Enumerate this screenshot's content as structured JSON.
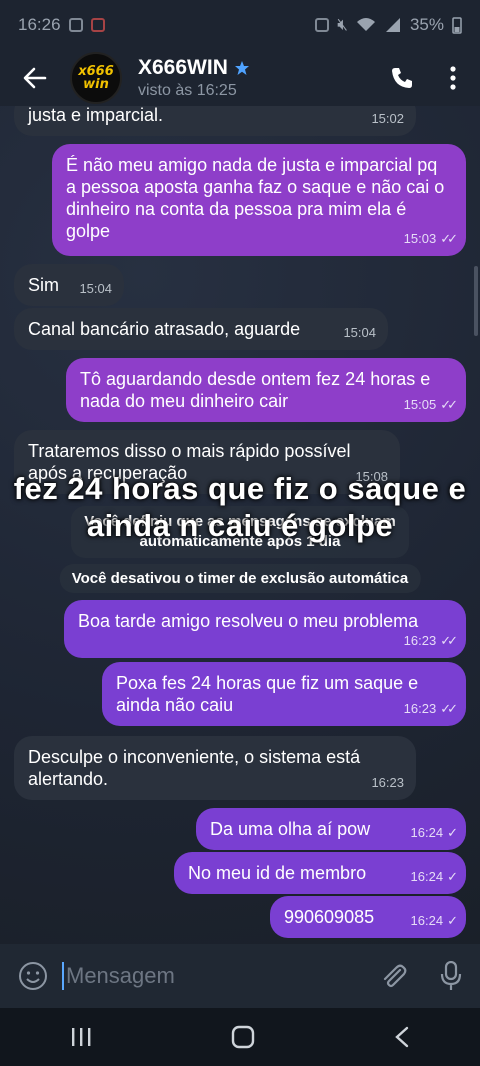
{
  "status": {
    "time": "16:26",
    "battery": "35%"
  },
  "header": {
    "name": "X666WIN",
    "last_seen": "visto às 16:25",
    "avatar_line1": "x666",
    "avatar_line2": "win"
  },
  "messages": [
    {
      "text": "justa e imparcial.",
      "time": "15:02"
    },
    {
      "text": "É não meu amigo nada de justa e imparcial pq a pessoa aposta ganha faz o saque e não cai o dinheiro na conta da pessoa pra mim ela é golpe",
      "time": "15:03"
    },
    {
      "text": "Sim",
      "time": "15:04"
    },
    {
      "text": "Canal bancário atrasado, aguarde",
      "time": "15:04"
    },
    {
      "text": "Tô aguardando desde ontem fez 24 horas e nada do meu dinheiro cair",
      "time": "15:05"
    },
    {
      "text": "Trataremos disso o mais rápido possível após a recuperação",
      "time": "15:08"
    },
    {
      "text": "Boa tarde amigo resolveu o meu problema",
      "time": "16:23"
    },
    {
      "text": "Poxa fes 24 horas que fiz um saque e ainda não caiu",
      "time": "16:23"
    },
    {
      "text": "Desculpe o inconveniente, o sistema está alertando.",
      "time": "16:23"
    },
    {
      "text": "Da uma olha aí pow",
      "time": "16:24"
    },
    {
      "text": "No meu id de membro",
      "time": "16:24"
    },
    {
      "text": "990609085",
      "time": "16:24"
    }
  ],
  "service": {
    "s1": "Você definiu que as mensagens se excluam automaticamente após 1 dia",
    "s2": "Você desativou o timer de exclusão automática"
  },
  "overlay": "fez 24 horas que fiz o saque e ainda n caiu é golpe",
  "input": {
    "placeholder": "Mensagem"
  }
}
